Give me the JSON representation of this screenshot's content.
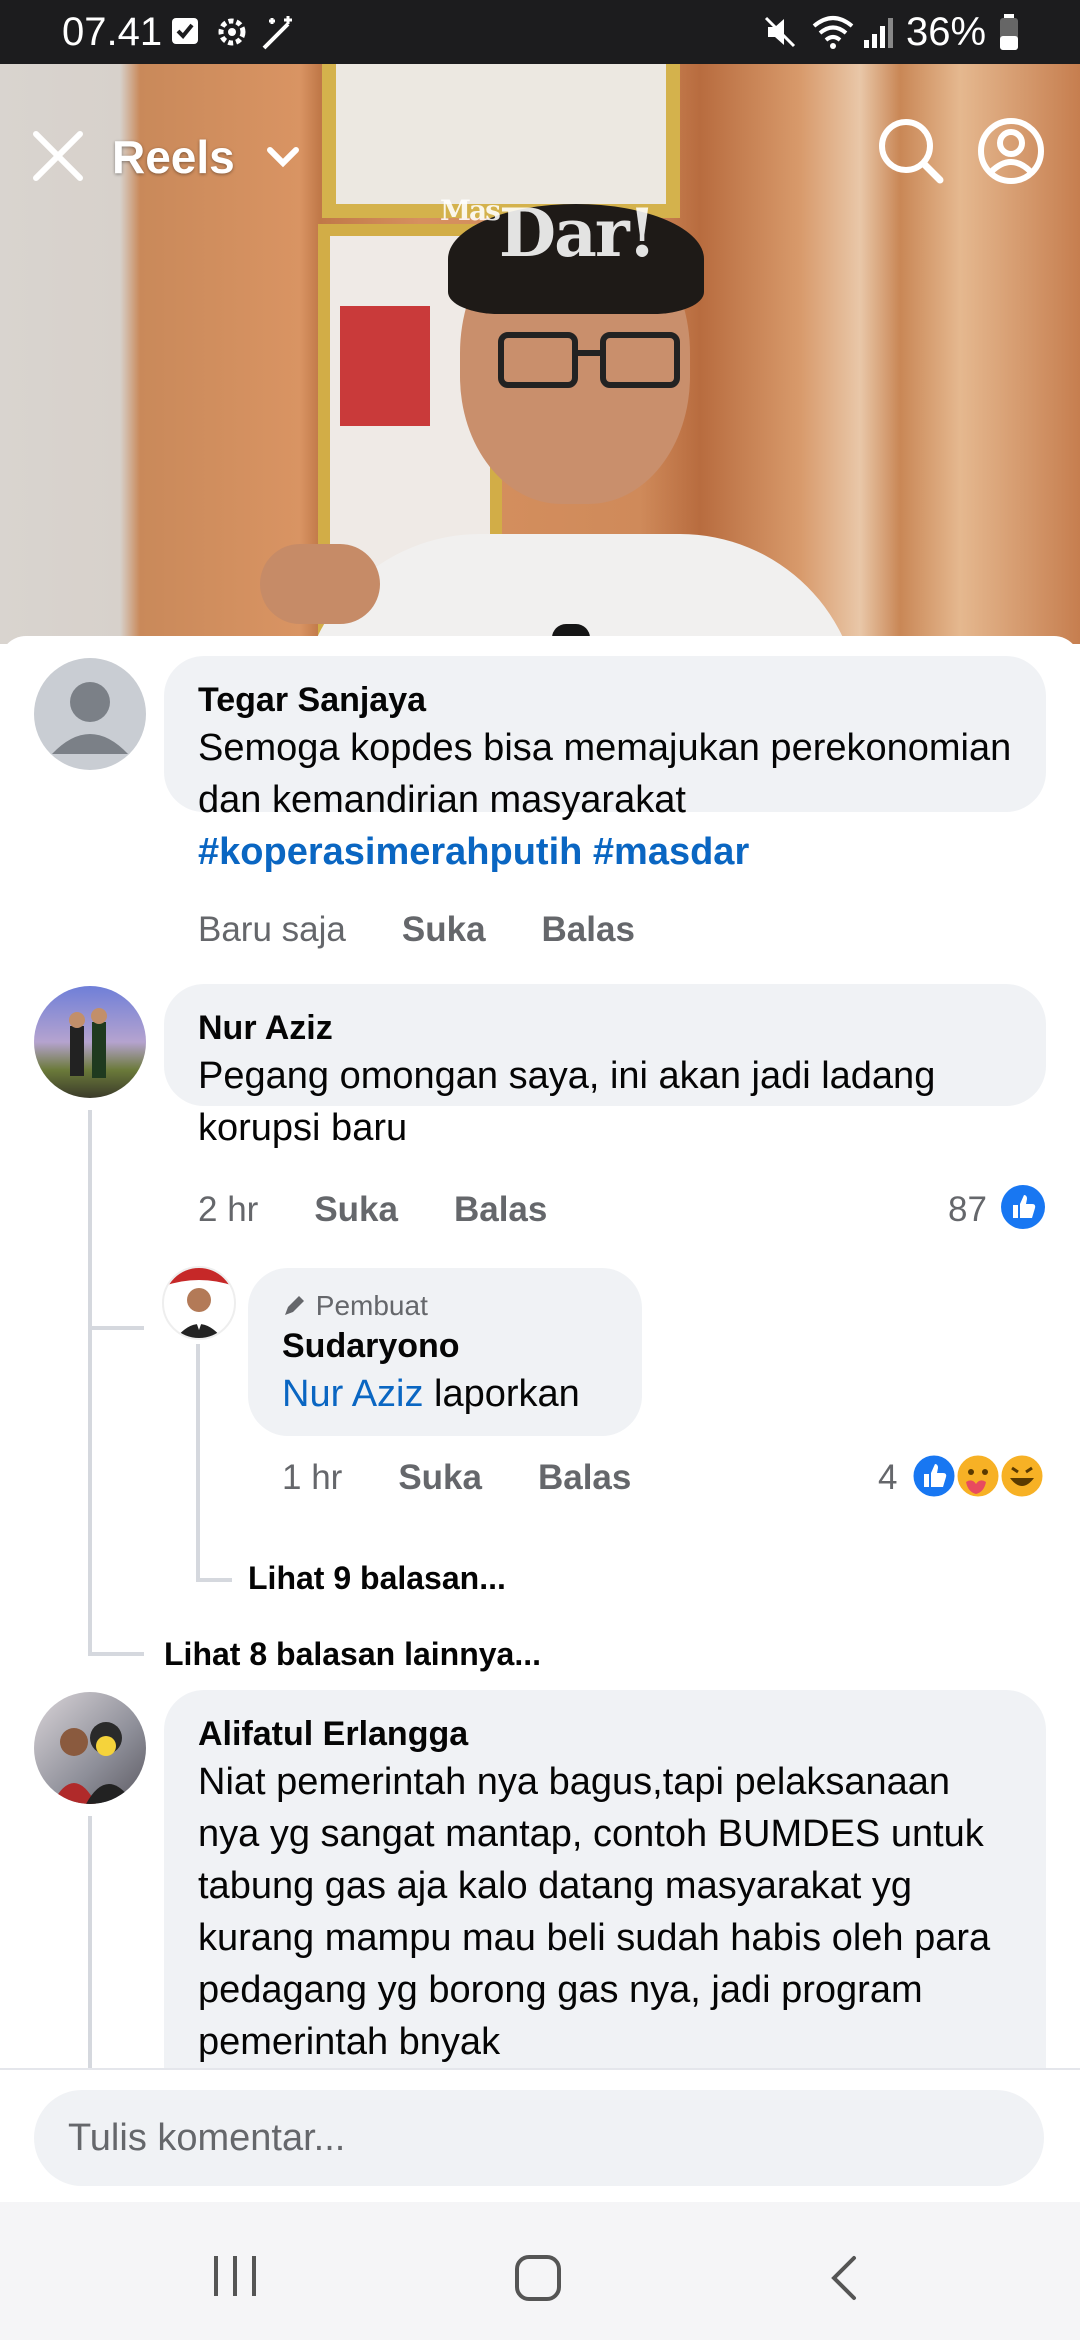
{
  "status_bar": {
    "time": "07.41",
    "battery": "36%"
  },
  "header": {
    "title": "Reels"
  },
  "video": {
    "watermark_main": "Dar!",
    "watermark_small": "Mas"
  },
  "comments": [
    {
      "name": "Tegar Sanjaya",
      "text": "Semoga kopdes bisa memajukan perekonomian dan kemandirian masyarakat ",
      "tags": [
        "#koperasimerahputih",
        "#masdar"
      ],
      "time": "Baru saja",
      "like_label": "Suka",
      "reply_label": "Balas"
    },
    {
      "name": "Nur Aziz",
      "text": "Pegang omongan saya, ini akan jadi ladang korupsi baru",
      "time": "2 hr",
      "like_label": "Suka",
      "reply_label": "Balas",
      "reaction_count": "87",
      "reply": {
        "badge": "Pembuat",
        "name": "Sudaryono",
        "mention": "Nur Aziz",
        "text": " laporkan",
        "time": "1 hr",
        "like_label": "Suka",
        "reply_label": "Balas",
        "reaction_count": "4",
        "view_replies": "Lihat 9 balasan..."
      },
      "view_more": "Lihat 8 balasan lainnya..."
    },
    {
      "name": "Alifatul Erlangga",
      "text": "Niat pemerintah nya bagus,tapi pelaksanaan nya yg sangat mantap, contoh BUMDES untuk tabung gas aja kalo datang masyarakat yg kurang mampu mau beli sudah habis oleh para pedagang yg borong gas nya, jadi program pemerintah bnyak"
    }
  ],
  "composer": {
    "placeholder": "Tulis komentar..."
  },
  "colors": {
    "link": "#0a66c2",
    "bubble": "#f0f2f5",
    "like_blue": "#1877f2"
  }
}
